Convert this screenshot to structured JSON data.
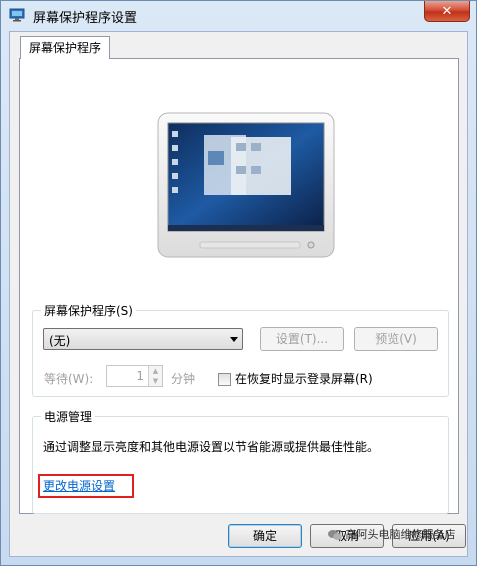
{
  "window": {
    "title": "屏幕保护程序设置",
    "close_symbol": "✕"
  },
  "tab": {
    "label": "屏幕保护程序"
  },
  "screensaver": {
    "group_label": "屏幕保护程序(S)",
    "selected_value": "(无)",
    "settings_button": "设置(T)...",
    "preview_button": "预览(V)",
    "wait_label": "等待(W):",
    "wait_value": "1",
    "minutes_label": "分钟",
    "resume_checkbox_label": "在恢复时显示登录屏幕(R)",
    "resume_checked": false
  },
  "power": {
    "group_label": "电源管理",
    "description": "通过调整显示亮度和其他电源设置以节省能源或提供最佳性能。",
    "link": "更改电源设置"
  },
  "footer": {
    "ok_button": "确定",
    "cancel_button": "取消",
    "apply_button": "应用(A)"
  },
  "watermark": {
    "text": "高阿头电脑维修服务店"
  },
  "colors": {
    "link": "#0066cc",
    "highlight_box": "#e02020",
    "close_button": "#c1301b"
  },
  "icons": {
    "title": "display-properties-icon",
    "close": "close-icon",
    "dropdown": "chevron-down-icon",
    "watermark": "wechat-icon"
  }
}
